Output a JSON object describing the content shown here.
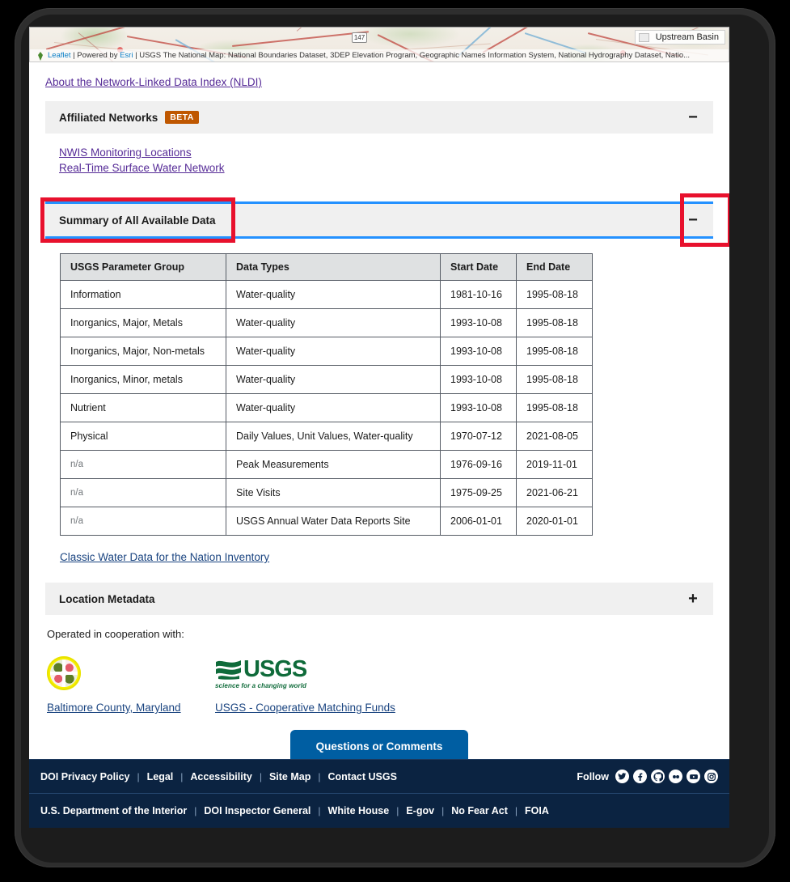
{
  "map": {
    "upstream_basin_label": "Upstream Basin",
    "route_shield": "147",
    "attribution_prefix": "Leaflet",
    "attribution_mid": " | Powered by ",
    "attribution_esri": "Esri",
    "attribution_rest": " | USGS The National Map: National Boundaries Dataset, 3DEP Elevation Program, Geographic Names Information System, National Hydrography Dataset, Natio..."
  },
  "nldi_link": "About the Network-Linked Data Index (NLDI)",
  "affiliated": {
    "title": "Affiliated Networks",
    "badge": "BETA",
    "toggle_icon": "minus-icon",
    "links": [
      "NWIS Monitoring Locations",
      "Real-Time Surface Water Network"
    ]
  },
  "summary": {
    "title": "Summary of All Available Data",
    "toggle_icon": "minus-icon",
    "columns": [
      "USGS Parameter Group",
      "Data Types",
      "Start Date",
      "End Date"
    ],
    "rows": [
      {
        "group": "Information",
        "types": "Water-quality",
        "start": "1981-10-16",
        "end": "1995-08-18",
        "na": false
      },
      {
        "group": "Inorganics, Major, Metals",
        "types": "Water-quality",
        "start": "1993-10-08",
        "end": "1995-08-18",
        "na": false
      },
      {
        "group": "Inorganics, Major, Non-metals",
        "types": "Water-quality",
        "start": "1993-10-08",
        "end": "1995-08-18",
        "na": false
      },
      {
        "group": "Inorganics, Minor, metals",
        "types": "Water-quality",
        "start": "1993-10-08",
        "end": "1995-08-18",
        "na": false
      },
      {
        "group": "Nutrient",
        "types": "Water-quality",
        "start": "1993-10-08",
        "end": "1995-08-18",
        "na": false
      },
      {
        "group": "Physical",
        "types": "Daily Values, Unit Values, Water-quality",
        "start": "1970-07-12",
        "end": "2021-08-05",
        "na": false
      },
      {
        "group": "n/a",
        "types": "Peak Measurements",
        "start": "1976-09-16",
        "end": "2019-11-01",
        "na": true
      },
      {
        "group": "n/a",
        "types": "Site Visits",
        "start": "1975-09-25",
        "end": "2021-06-21",
        "na": true
      },
      {
        "group": "n/a",
        "types": "USGS Annual Water Data Reports Site",
        "start": "2006-01-01",
        "end": "2020-01-01",
        "na": true
      }
    ],
    "classic_link": "Classic Water Data for the Nation Inventory"
  },
  "location_metadata": {
    "title": "Location Metadata",
    "toggle_icon": "plus-icon"
  },
  "cooperation": {
    "label": "Operated in cooperation with:",
    "partners": [
      {
        "name": "Baltimore County, Maryland",
        "logo": "baltimore-county-seal"
      },
      {
        "name": "USGS - Cooperative Matching Funds",
        "logo": "usgs-logo"
      }
    ],
    "usgs_wordmark": "USGS",
    "usgs_tagline": "science for a changing world"
  },
  "cta": {
    "label": "Questions or Comments"
  },
  "footer": {
    "primary_links": [
      "DOI Privacy Policy",
      "Legal",
      "Accessibility",
      "Site Map",
      "Contact USGS"
    ],
    "follow_label": "Follow",
    "social": [
      "twitter-icon",
      "facebook-icon",
      "github-icon",
      "flickr-icon",
      "youtube-icon",
      "instagram-icon"
    ],
    "secondary_links": [
      "U.S. Department of the Interior",
      "DOI Inspector General",
      "White House",
      "E-gov",
      "No Fear Act",
      "FOIA"
    ],
    "separator": "|"
  },
  "annotations": {
    "highlight_color": "#e8112d",
    "focus_color": "#2491ff",
    "boxes": [
      "summary-header-title",
      "summary-header-toggle"
    ]
  },
  "colors": {
    "accent_blue": "#005ea2",
    "link_blue": "#1a4480",
    "link_purple": "#562b97",
    "beta_orange": "#bf5700",
    "footer_navy": "#0b2341",
    "usgs_green": "#0f6b3a"
  }
}
